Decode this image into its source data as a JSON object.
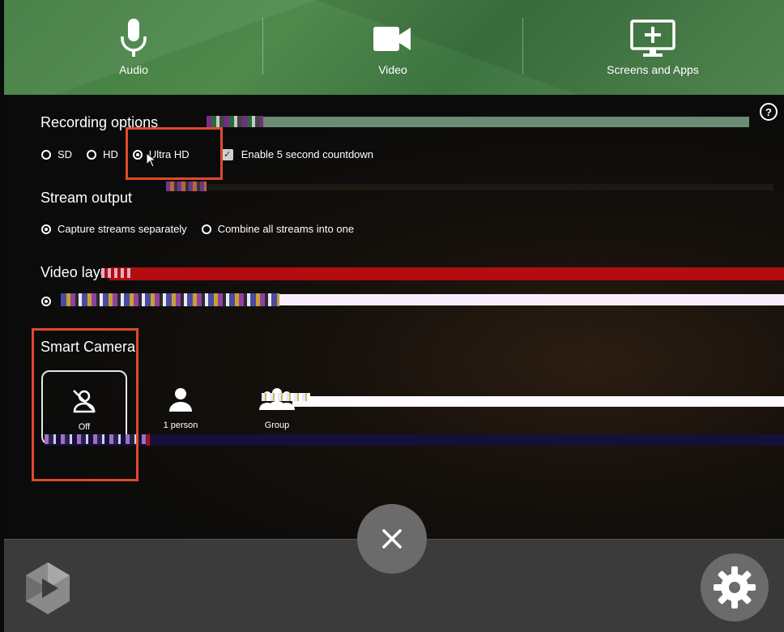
{
  "tabs": [
    {
      "label": "Audio",
      "icon": "microphone-icon"
    },
    {
      "label": "Video",
      "icon": "video-camera-icon"
    },
    {
      "label": "Screens and Apps",
      "icon": "screen-add-icon"
    }
  ],
  "recording": {
    "title": "Recording options",
    "options": [
      "SD",
      "HD",
      "Ultra HD"
    ],
    "selected": "Ultra HD",
    "countdown_label": "Enable 5 second countdown",
    "countdown_checked": true
  },
  "stream": {
    "title": "Stream output",
    "options": [
      "Capture streams separately",
      "Combine all streams into one"
    ],
    "selected": "Capture streams separately"
  },
  "video_layout": {
    "title": "Video layo"
  },
  "smart_camera": {
    "title": "Smart Camera",
    "options": [
      {
        "label": "Off",
        "icon": "person-off-icon"
      },
      {
        "label": "1 person",
        "icon": "person-icon"
      },
      {
        "label": "Group",
        "icon": "group-icon"
      }
    ],
    "selected": "Off"
  },
  "help": {
    "label": "?"
  },
  "colors": {
    "header_green": "#4f8a4c",
    "highlight_red": "#e04a2a",
    "bottom_bar": "#3b3b3b",
    "button_gray": "#6b6b6b"
  }
}
